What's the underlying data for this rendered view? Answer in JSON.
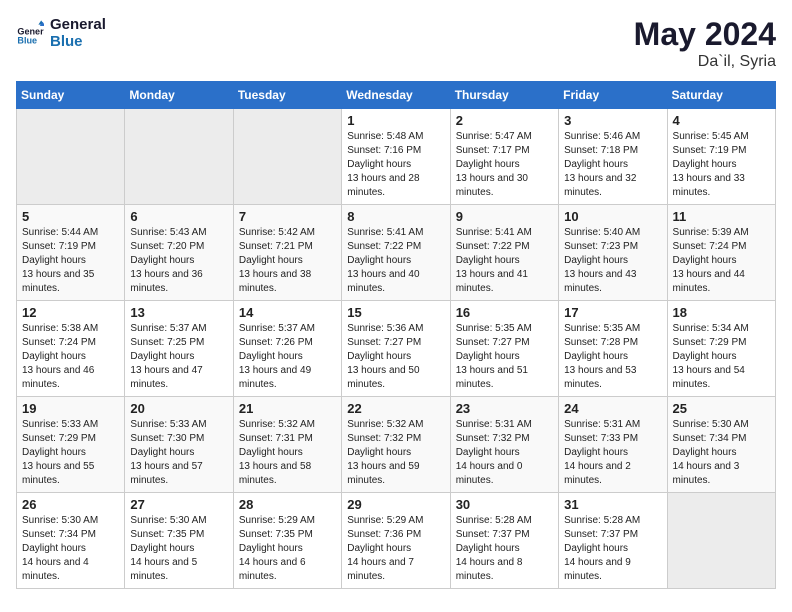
{
  "logo": {
    "line1": "General",
    "line2": "Blue"
  },
  "title": "May 2024",
  "location": "Da`il, Syria",
  "days_of_week": [
    "Sunday",
    "Monday",
    "Tuesday",
    "Wednesday",
    "Thursday",
    "Friday",
    "Saturday"
  ],
  "weeks": [
    [
      {
        "day": "",
        "empty": true
      },
      {
        "day": "",
        "empty": true
      },
      {
        "day": "",
        "empty": true
      },
      {
        "day": "1",
        "sunrise": "5:48 AM",
        "sunset": "7:16 PM",
        "daylight": "13 hours and 28 minutes."
      },
      {
        "day": "2",
        "sunrise": "5:47 AM",
        "sunset": "7:17 PM",
        "daylight": "13 hours and 30 minutes."
      },
      {
        "day": "3",
        "sunrise": "5:46 AM",
        "sunset": "7:18 PM",
        "daylight": "13 hours and 32 minutes."
      },
      {
        "day": "4",
        "sunrise": "5:45 AM",
        "sunset": "7:19 PM",
        "daylight": "13 hours and 33 minutes."
      }
    ],
    [
      {
        "day": "5",
        "sunrise": "5:44 AM",
        "sunset": "7:19 PM",
        "daylight": "13 hours and 35 minutes."
      },
      {
        "day": "6",
        "sunrise": "5:43 AM",
        "sunset": "7:20 PM",
        "daylight": "13 hours and 36 minutes."
      },
      {
        "day": "7",
        "sunrise": "5:42 AM",
        "sunset": "7:21 PM",
        "daylight": "13 hours and 38 minutes."
      },
      {
        "day": "8",
        "sunrise": "5:41 AM",
        "sunset": "7:22 PM",
        "daylight": "13 hours and 40 minutes."
      },
      {
        "day": "9",
        "sunrise": "5:41 AM",
        "sunset": "7:22 PM",
        "daylight": "13 hours and 41 minutes."
      },
      {
        "day": "10",
        "sunrise": "5:40 AM",
        "sunset": "7:23 PM",
        "daylight": "13 hours and 43 minutes."
      },
      {
        "day": "11",
        "sunrise": "5:39 AM",
        "sunset": "7:24 PM",
        "daylight": "13 hours and 44 minutes."
      }
    ],
    [
      {
        "day": "12",
        "sunrise": "5:38 AM",
        "sunset": "7:24 PM",
        "daylight": "13 hours and 46 minutes."
      },
      {
        "day": "13",
        "sunrise": "5:37 AM",
        "sunset": "7:25 PM",
        "daylight": "13 hours and 47 minutes."
      },
      {
        "day": "14",
        "sunrise": "5:37 AM",
        "sunset": "7:26 PM",
        "daylight": "13 hours and 49 minutes."
      },
      {
        "day": "15",
        "sunrise": "5:36 AM",
        "sunset": "7:27 PM",
        "daylight": "13 hours and 50 minutes."
      },
      {
        "day": "16",
        "sunrise": "5:35 AM",
        "sunset": "7:27 PM",
        "daylight": "13 hours and 51 minutes."
      },
      {
        "day": "17",
        "sunrise": "5:35 AM",
        "sunset": "7:28 PM",
        "daylight": "13 hours and 53 minutes."
      },
      {
        "day": "18",
        "sunrise": "5:34 AM",
        "sunset": "7:29 PM",
        "daylight": "13 hours and 54 minutes."
      }
    ],
    [
      {
        "day": "19",
        "sunrise": "5:33 AM",
        "sunset": "7:29 PM",
        "daylight": "13 hours and 55 minutes."
      },
      {
        "day": "20",
        "sunrise": "5:33 AM",
        "sunset": "7:30 PM",
        "daylight": "13 hours and 57 minutes."
      },
      {
        "day": "21",
        "sunrise": "5:32 AM",
        "sunset": "7:31 PM",
        "daylight": "13 hours and 58 minutes."
      },
      {
        "day": "22",
        "sunrise": "5:32 AM",
        "sunset": "7:32 PM",
        "daylight": "13 hours and 59 minutes."
      },
      {
        "day": "23",
        "sunrise": "5:31 AM",
        "sunset": "7:32 PM",
        "daylight": "14 hours and 0 minutes."
      },
      {
        "day": "24",
        "sunrise": "5:31 AM",
        "sunset": "7:33 PM",
        "daylight": "14 hours and 2 minutes."
      },
      {
        "day": "25",
        "sunrise": "5:30 AM",
        "sunset": "7:34 PM",
        "daylight": "14 hours and 3 minutes."
      }
    ],
    [
      {
        "day": "26",
        "sunrise": "5:30 AM",
        "sunset": "7:34 PM",
        "daylight": "14 hours and 4 minutes."
      },
      {
        "day": "27",
        "sunrise": "5:30 AM",
        "sunset": "7:35 PM",
        "daylight": "14 hours and 5 minutes."
      },
      {
        "day": "28",
        "sunrise": "5:29 AM",
        "sunset": "7:35 PM",
        "daylight": "14 hours and 6 minutes."
      },
      {
        "day": "29",
        "sunrise": "5:29 AM",
        "sunset": "7:36 PM",
        "daylight": "14 hours and 7 minutes."
      },
      {
        "day": "30",
        "sunrise": "5:28 AM",
        "sunset": "7:37 PM",
        "daylight": "14 hours and 8 minutes."
      },
      {
        "day": "31",
        "sunrise": "5:28 AM",
        "sunset": "7:37 PM",
        "daylight": "14 hours and 9 minutes."
      },
      {
        "day": "",
        "empty": true
      }
    ]
  ],
  "labels": {
    "sunrise": "Sunrise:",
    "sunset": "Sunset:",
    "daylight": "Daylight hours"
  }
}
